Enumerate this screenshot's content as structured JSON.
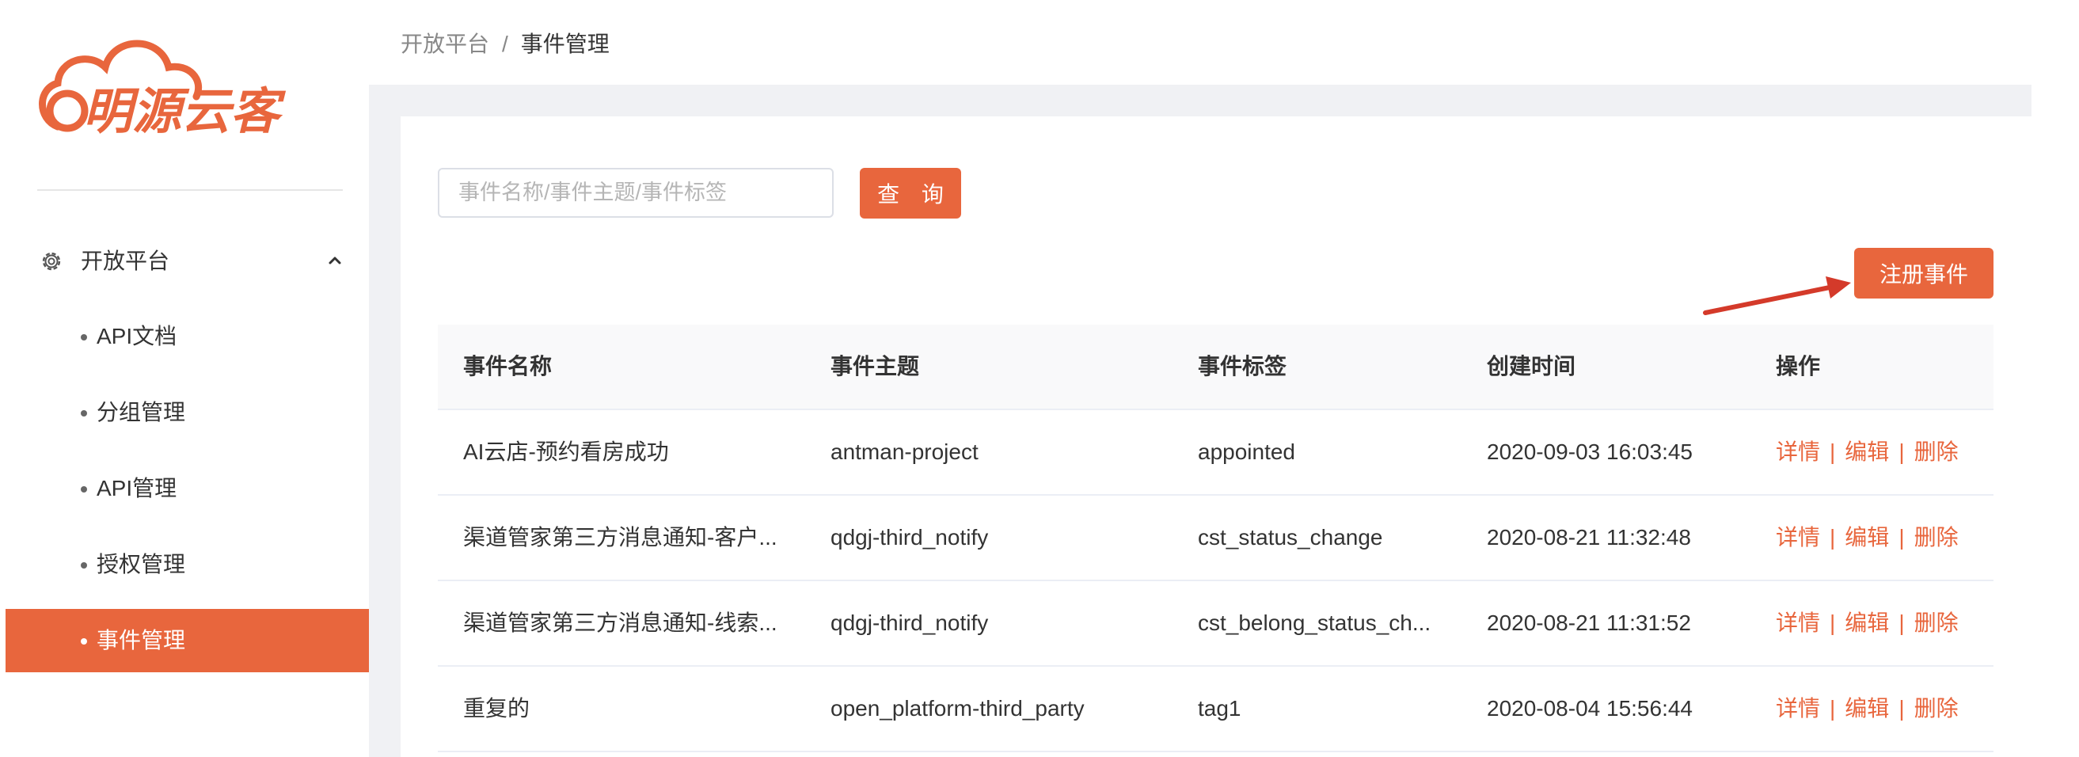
{
  "brand": {
    "logo_text": "明源云客",
    "color": "#e8663d"
  },
  "breadcrumb": {
    "root": "开放平台",
    "separator": "/",
    "current": "事件管理"
  },
  "sidebar": {
    "group": {
      "label": "开放平台",
      "icon": "gear-icon",
      "expanded": true
    },
    "items": [
      {
        "label": "API文档"
      },
      {
        "label": "分组管理"
      },
      {
        "label": "API管理"
      },
      {
        "label": "授权管理"
      },
      {
        "label": "事件管理",
        "active": true
      }
    ]
  },
  "search": {
    "placeholder": "事件名称/事件主题/事件标签",
    "value": "",
    "query_button": "查 询"
  },
  "toolbar": {
    "register_button": "注册事件"
  },
  "table": {
    "columns": [
      "事件名称",
      "事件主题",
      "事件标签",
      "创建时间",
      "操作"
    ],
    "rows": [
      {
        "name": "AI云店-预约看房成功",
        "topic": "antman-project",
        "tag": "appointed",
        "created": "2020-09-03 16:03:45"
      },
      {
        "name": "渠道管家第三方消息通知-客户...",
        "topic": "qdgj-third_notify",
        "tag": "cst_status_change",
        "created": "2020-08-21 11:32:48"
      },
      {
        "name": "渠道管家第三方消息通知-线索...",
        "topic": "qdgj-third_notify",
        "tag": "cst_belong_status_ch...",
        "created": "2020-08-21 11:31:52"
      },
      {
        "name": "重复的",
        "topic": "open_platform-third_party",
        "tag": "tag1",
        "created": "2020-08-04 15:56:44"
      }
    ],
    "actions": {
      "detail": "详情",
      "edit": "编辑",
      "delete": "删除",
      "separator": "|"
    }
  }
}
